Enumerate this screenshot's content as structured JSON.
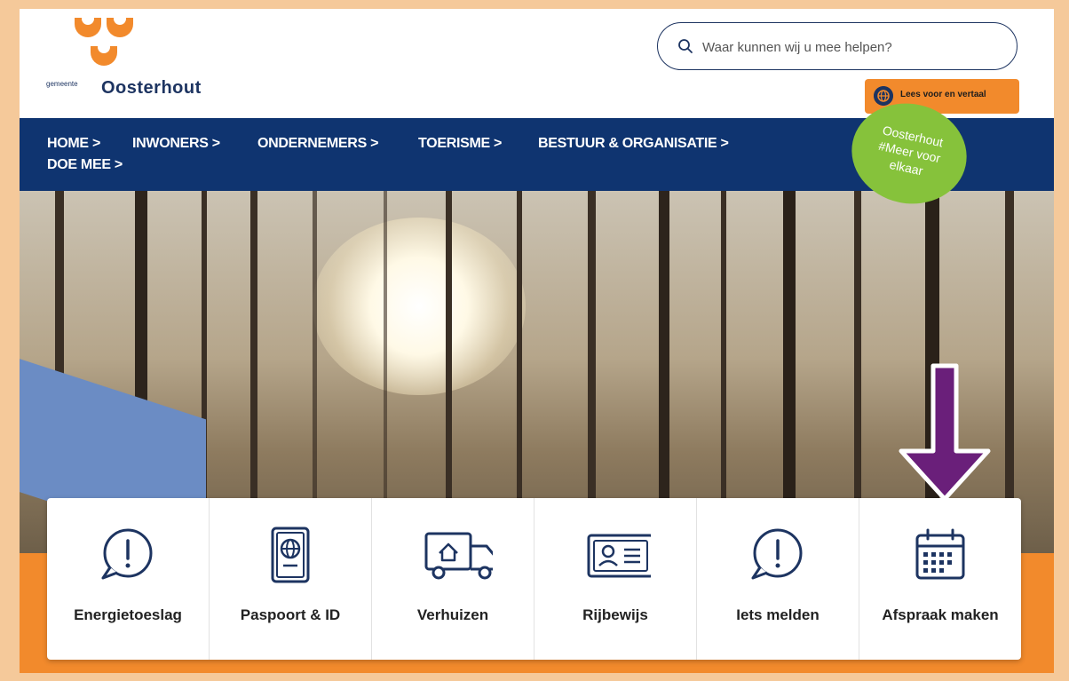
{
  "header": {
    "logo_small": "gemeente",
    "logo_name": "Oosterhout",
    "search_placeholder": "Waar kunnen wij u mee helpen?",
    "read_button_label": "Lees voor en vertaal"
  },
  "nav": {
    "items": [
      {
        "label": "HOME >"
      },
      {
        "label": "INWONERS >"
      },
      {
        "label": "ONDERNEMERS >"
      },
      {
        "label": "TOERISME >"
      },
      {
        "label": "BESTUUR & ORGANISATIE >"
      },
      {
        "label": "DOE MEE >"
      }
    ]
  },
  "badge": {
    "line1": "Oosterhout",
    "line2": "#Meer voor",
    "line3": "elkaar"
  },
  "tiles": [
    {
      "label": "Energietoeslag",
      "icon": "exclamation-bubble-icon"
    },
    {
      "label": "Paspoort & ID",
      "icon": "passport-icon"
    },
    {
      "label": "Verhuizen",
      "icon": "moving-truck-icon"
    },
    {
      "label": "Rijbewijs",
      "icon": "id-card-icon"
    },
    {
      "label": "Iets melden",
      "icon": "exclamation-bubble-icon"
    },
    {
      "label": "Afspraak maken",
      "icon": "calendar-icon"
    }
  ],
  "colors": {
    "navy": "#0f3470",
    "orange": "#f28a2c",
    "green": "#86c23b",
    "arrow": "#6a1f7a",
    "frame": "#f5c99a"
  }
}
